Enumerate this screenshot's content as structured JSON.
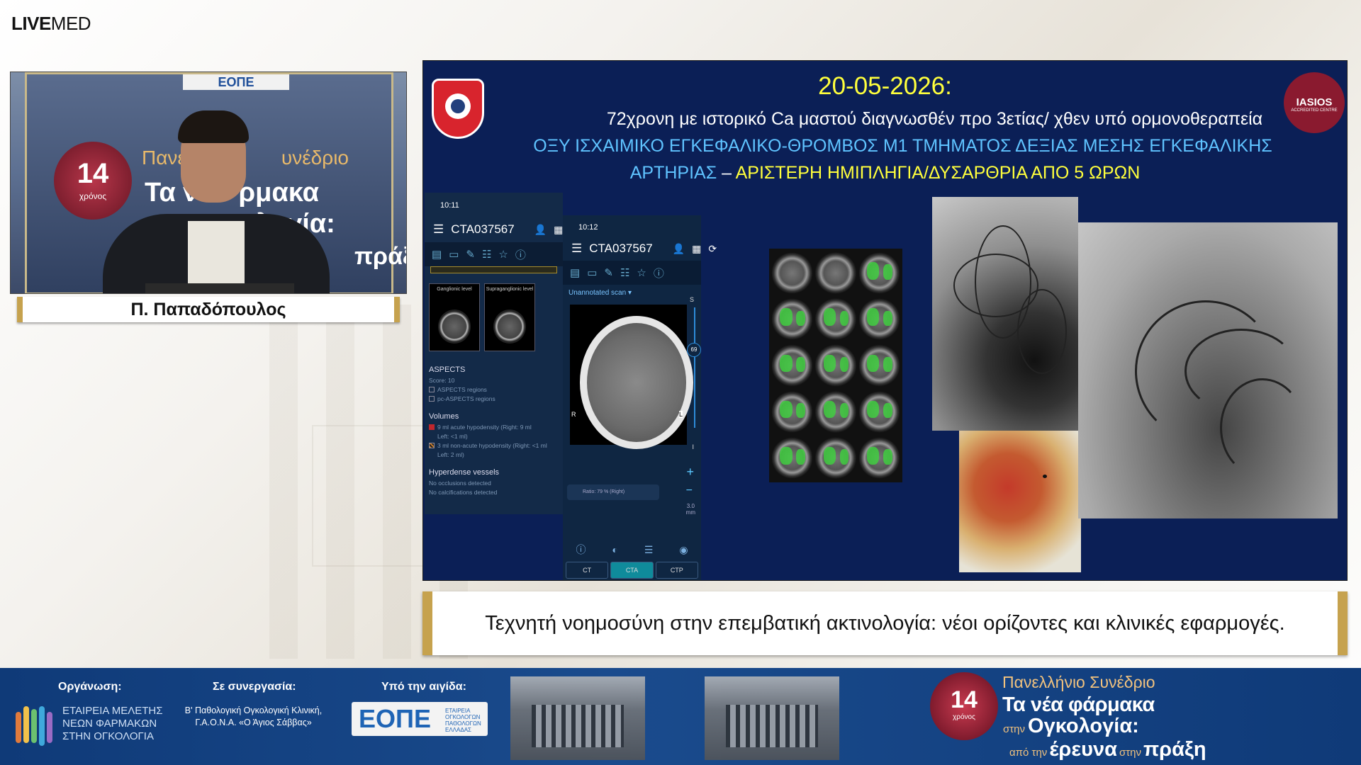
{
  "brand": {
    "bold": "LIVE",
    "light": "MED"
  },
  "speaker": {
    "name": "Π. Παπαδόπουλος",
    "backdrop": {
      "logo": "ΕΟΠΕ",
      "seal_number": "14",
      "seal_sub": "χρόνος",
      "line1": "Πανελ",
      "line1b": "υνέδριο",
      "line2": "Τα νέ",
      "line2b": "ρμακα",
      "line3": "ολογία:",
      "line4": "πράξη"
    }
  },
  "slide": {
    "date": "20-05-2026:",
    "line1": "72χρονη με ιστορικό Ca μαστού διαγνωσθέν προ 3ετίας/ χθεν υπό ορμονοθεραπεία",
    "line2": "ΟΞΥ ΙΣΧΑΙΜΙΚΟ ΕΓΚΕΦΑΛΙΚΟ-ΘΡΟΜΒΟΣ Μ1 ΤΜΗΜΑΤΟΣ ΔΕΞΙΑΣ ΜΕΣΗΣ ΕΓΚΕΦΑΛΙΚΗΣ",
    "line3a": "ΑΡΤΗΡΙΑΣ",
    "line3dash": " – ",
    "line3b": "ΑΡΙΣΤΕΡΗ ΗΜΙΠΛΗΓΙΑ/ΔΥΣΑΡΘΡΙΑ ΑΠΟ 5 ΩΡΩΝ",
    "iasios": "IASIOS",
    "iasios_sub": "ACCREDITED CENTRE",
    "colors": {
      "background": "#0b1f56",
      "date": "#ffff3c",
      "cyan": "#5fc3ff"
    },
    "app1": {
      "time": "10:11",
      "scan_id": "CTA037567",
      "thumbs": [
        "Ganglionic level",
        "Supraganglionic level"
      ],
      "aspects_title": "ASPECTS",
      "score": "Score: 10",
      "opt1": "ASPECTS regions",
      "opt2": "pc-ASPECTS regions",
      "volumes_title": "Volumes",
      "vol1": "9 ml acute hypodensity (Right: 9 ml",
      "vol1b": "Left: <1 ml)",
      "vol2": "3 ml non-acute hypodensity (Right: <1 ml",
      "vol2b": "Left: 2 ml)",
      "hyper_title": "Hyperdense vessels",
      "hyper1": "No occlusions detected",
      "hyper2": "No calcifications detected"
    },
    "app2": {
      "time": "10:12",
      "scan_id": "CTA037567",
      "scan_label": "Unannotated scan",
      "slice_value": "69",
      "ratio": "Ratio: 79 % (Right)",
      "thickness": "3.0",
      "thickness_unit": "mm",
      "side_right": "R",
      "side_left": "L",
      "s_label": "S",
      "i_label": "I",
      "tabs": [
        "CT",
        "CTA",
        "CTP"
      ],
      "active_tab": "CTA"
    }
  },
  "lower_third": "Τεχνητή νοημοσύνη στην επεμβατική ακτινολογία: νέοι ορίζοντες και κλινικές εφαρμογές.",
  "footer": {
    "org_label": "Οργάνωση:",
    "org_text": [
      "ΕΤΑΙΡΕΙΑ ΜΕΛΕΤΗΣ",
      "ΝΕΩΝ ΦΑΡΜΑΚΩΝ",
      "ΣΤΗΝ ΟΓΚΟΛΟΓΙΑ"
    ],
    "collab_label": "Σε συνεργασία:",
    "collab_text1": "Β' Παθολογική Ογκολογική Κλινική,",
    "collab_text2": "Γ.Α.Ο.Ν.Α. «Ο Άγιος Σάββας»",
    "aegis_label": "Υπό την αιγίδα:",
    "eope": "ΕΟΠΕ",
    "eope_sub": [
      "ΕΤΑΙΡΕΙΑ",
      "ΟΓΚΟΛΟΓΩΝ",
      "ΠΑΘΟΛΟΓΩΝ",
      "ΕΛΛΑΔΑΣ"
    ],
    "seal_number": "14",
    "seal_sub": "χρόνος",
    "conf_line1": "Πανελλήνιο Συνέδριο",
    "conf_line2": "Τα νέα φάρμακα",
    "conf_line3a": "στην",
    "conf_line3b": "Ογκολογία:",
    "conf_line4a": "από την",
    "conf_line4b": "έρευνα",
    "conf_line4c": "στην",
    "conf_line4d": "πράξη",
    "colors": {
      "bar": "#0f3a78",
      "accent": "#f1c27e"
    }
  },
  "accent_gold": "#c6a24e"
}
